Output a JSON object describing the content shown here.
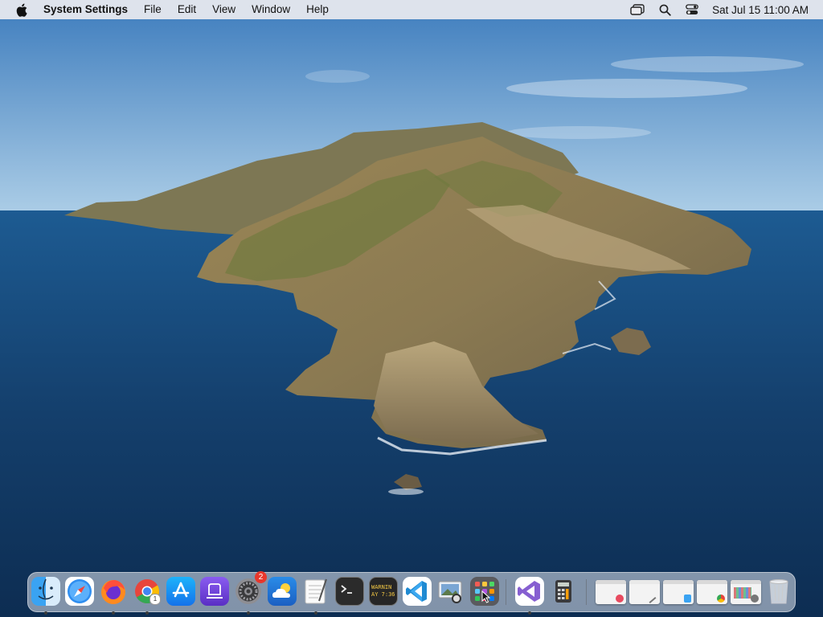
{
  "menubar": {
    "app_name": "System Settings",
    "menus": [
      "File",
      "Edit",
      "View",
      "Window",
      "Help"
    ],
    "clock": "Sat Jul 15  11:00 AM"
  },
  "dock": {
    "apps": [
      {
        "name": "Finder",
        "icon": "finder-icon",
        "running": true
      },
      {
        "name": "Safari",
        "icon": "safari-icon",
        "running": false
      },
      {
        "name": "Firefox",
        "icon": "firefox-icon",
        "running": true
      },
      {
        "name": "Google Chrome",
        "icon": "chrome-icon",
        "running": true
      },
      {
        "name": "App Store",
        "icon": "app-store-icon",
        "running": false
      },
      {
        "name": "Simulator",
        "icon": "simulator-icon",
        "running": false
      },
      {
        "name": "System Settings",
        "icon": "system-settings-icon",
        "running": true,
        "badge": "2"
      },
      {
        "name": "Weather",
        "icon": "weather-icon",
        "running": false
      },
      {
        "name": "TextEdit",
        "icon": "textedit-icon",
        "running": true
      },
      {
        "name": "Terminal",
        "icon": "terminal-icon",
        "running": false
      },
      {
        "name": "Console",
        "icon": "console-icon",
        "running": false,
        "text": "WARNIN\nAY 7:36"
      },
      {
        "name": "Visual Studio Code",
        "icon": "vscode-icon",
        "running": false
      },
      {
        "name": "Preview",
        "icon": "preview-icon",
        "running": false
      },
      {
        "name": "Launchpad",
        "icon": "launchpad-icon",
        "running": false
      },
      {
        "name": "Visual Studio",
        "icon": "visual-studio-icon",
        "running": true
      },
      {
        "name": "Calculator",
        "icon": "calculator-icon",
        "running": false
      }
    ],
    "trash": "trash-icon"
  },
  "colors": {
    "sky_top": "#3f7fc0",
    "sky_bottom": "#a9cbe4",
    "sea": "#14406e",
    "badge": "#e8372c"
  }
}
